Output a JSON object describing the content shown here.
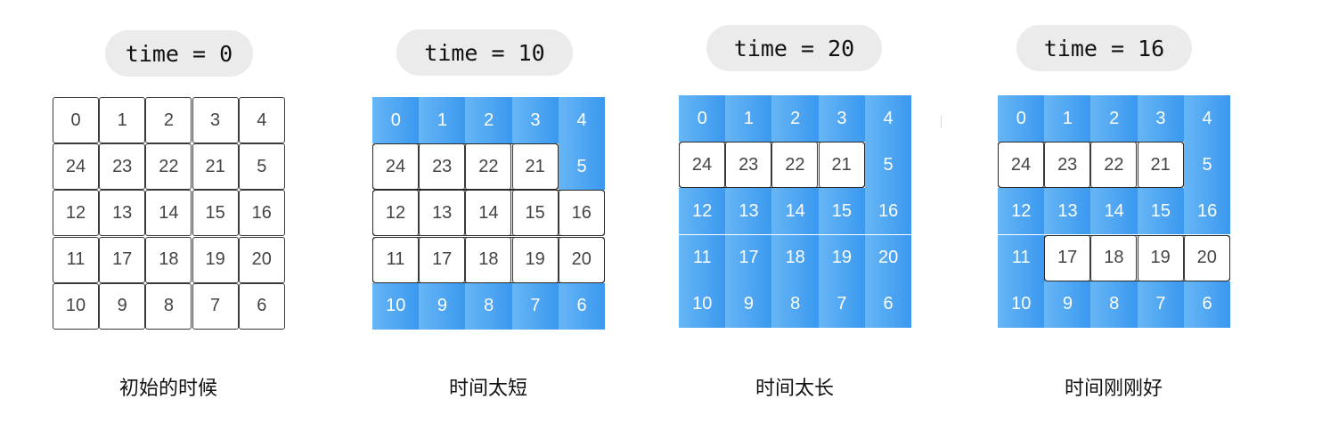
{
  "grid": [
    [
      0,
      1,
      2,
      3,
      4
    ],
    [
      24,
      23,
      22,
      21,
      5
    ],
    [
      12,
      13,
      14,
      15,
      16
    ],
    [
      11,
      17,
      18,
      19,
      20
    ],
    [
      10,
      9,
      8,
      7,
      6
    ]
  ],
  "panels": [
    {
      "time_label": "time = 0",
      "caption": "初始的时候",
      "fill": [
        [
          0,
          0,
          0,
          0,
          0
        ],
        [
          0,
          0,
          0,
          0,
          0
        ],
        [
          0,
          0,
          0,
          0,
          0
        ],
        [
          0,
          0,
          0,
          0,
          0
        ],
        [
          0,
          0,
          0,
          0,
          0
        ]
      ]
    },
    {
      "time_label": "time = 10",
      "caption": "时间太短",
      "fill": [
        [
          1,
          1,
          1,
          1,
          1
        ],
        [
          0,
          0,
          0,
          0,
          1
        ],
        [
          0,
          0,
          0,
          0,
          0
        ],
        [
          0,
          0,
          0,
          0,
          0
        ],
        [
          1,
          1,
          1,
          1,
          1
        ]
      ]
    },
    {
      "time_label": "time = 20",
      "caption": "时间太长",
      "fill": [
        [
          1,
          1,
          1,
          1,
          1
        ],
        [
          0,
          0,
          0,
          0,
          1
        ],
        [
          1,
          1,
          1,
          1,
          1
        ],
        [
          1,
          1,
          1,
          1,
          1
        ],
        [
          1,
          1,
          1,
          1,
          1
        ]
      ]
    },
    {
      "time_label": "time = 16",
      "caption": "时间刚刚好",
      "fill": [
        [
          1,
          1,
          1,
          1,
          1
        ],
        [
          0,
          0,
          0,
          0,
          1
        ],
        [
          1,
          1,
          1,
          1,
          1
        ],
        [
          1,
          0,
          0,
          0,
          0
        ],
        [
          1,
          1,
          1,
          1,
          1
        ]
      ]
    }
  ],
  "colors": {
    "filled": "#4aa6f2",
    "empty": "#ffffff",
    "border": "#3a3a3a",
    "pill": "#ebebeb"
  }
}
